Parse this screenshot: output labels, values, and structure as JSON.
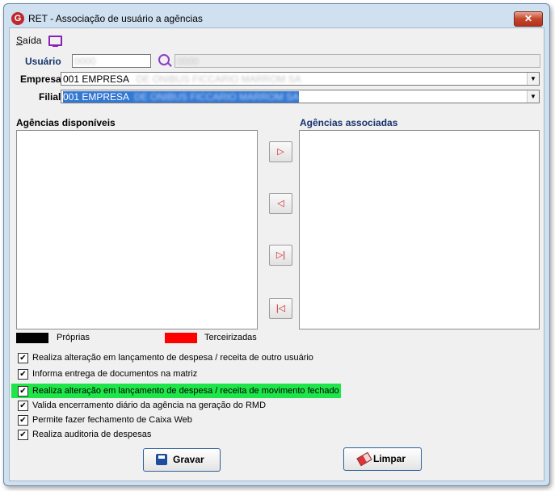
{
  "window": {
    "title": "RET -  Associação de usuário a agências",
    "close_label": "✕",
    "logo_letter": "G"
  },
  "menu": {
    "saida_first": "S",
    "saida_rest": "aída"
  },
  "form": {
    "usuario_label": "Usuário",
    "usuario_value": "0000",
    "usuario_name": "0000",
    "empresa_label": "Empresa",
    "empresa_value": "001 EMPRESA",
    "empresa_obscured": "DE ONIBUS FICCARIO MARROM SA",
    "filial_label": "Filial",
    "filial_value": "001 EMPRESA",
    "filial_obscured": "DE ONIBUS FICCARIO MARROM SA"
  },
  "lists": {
    "available_title": "Agências disponíveis",
    "associated_title": "Agências associadas"
  },
  "transfer_buttons": {
    "add": "▷",
    "remove": "◁",
    "add_all": "▷|",
    "remove_all": "|◁"
  },
  "legend": {
    "own_label": "Próprias",
    "own_color": "#000000",
    "third_label": "Terceirizadas",
    "third_color": "#ff0000"
  },
  "options": [
    {
      "label": "Realiza alteração em lançamento de despesa / receita de outro usuário",
      "checked": true
    },
    {
      "label": "Informa entrega de documentos na matriz",
      "checked": true
    },
    {
      "label": "Realiza alteração em lançamento de despesa / receita de movimento fechado",
      "checked": true,
      "highlighted": true
    },
    {
      "label": "Valida encerramento diário da agência na geração do RMD",
      "checked": true
    },
    {
      "label": "Permite fazer fechamento de Caixa Web",
      "checked": true
    },
    {
      "label": "Realiza auditoria de despesas",
      "checked": true
    }
  ],
  "check_mark": "✔",
  "combo_arrow": "▼",
  "buttons": {
    "save_label": "Gravar",
    "clear_label": "Limpar"
  }
}
